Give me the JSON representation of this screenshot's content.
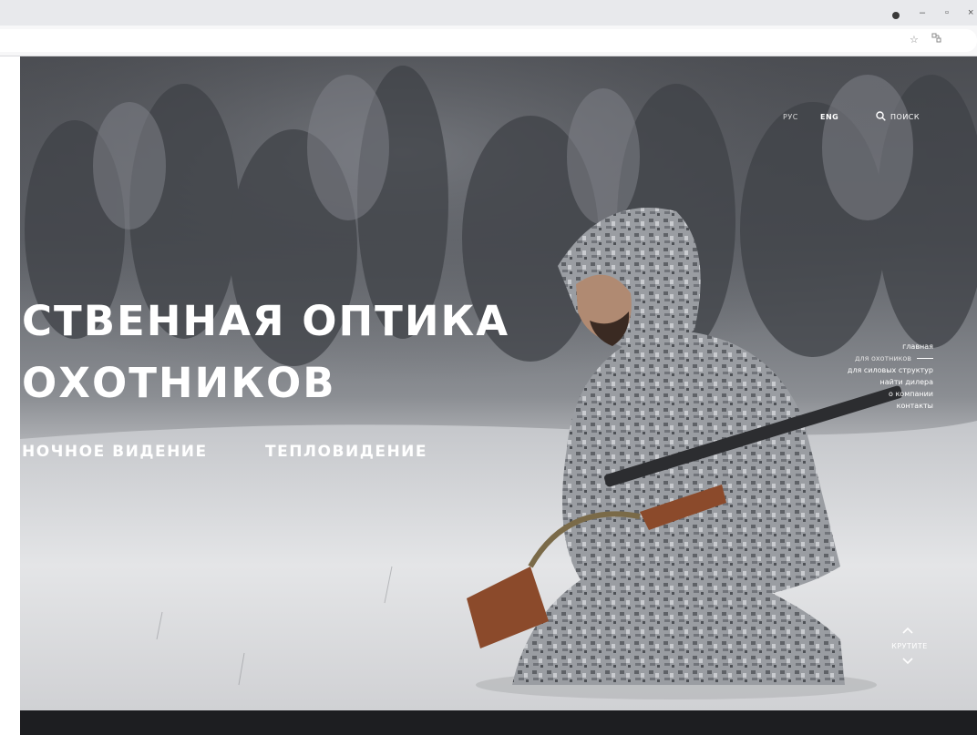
{
  "browser": {
    "window_controls": {
      "minimize": "–",
      "maximize": "▫",
      "close": "×"
    },
    "toolbar_icons": [
      "star-icon",
      "extension-icon"
    ]
  },
  "header": {
    "lang_ru": "РУС",
    "lang_en": "ENG",
    "search_label": "ПОИСК",
    "search_icon": "search-icon"
  },
  "hero": {
    "headline_line1": "СТВЕННАЯ ОПТИКА",
    "headline_line2": "ОХОТНИКОВ",
    "categories": [
      {
        "label": "НОЧНОЕ ВИДЕНИЕ"
      },
      {
        "label": "ТЕПЛОВИДЕНИЕ"
      }
    ]
  },
  "side_menu": {
    "items": [
      {
        "label": "главная",
        "active": false
      },
      {
        "label": "для охотников",
        "active": true
      },
      {
        "label": "для силовых структур",
        "active": false
      },
      {
        "label": "найти дилера",
        "active": false
      },
      {
        "label": "о компании",
        "active": false
      },
      {
        "label": "контакты",
        "active": false
      }
    ]
  },
  "scroll_hint": {
    "label": "КРУТИТЕ",
    "up_icon": "chevron-up-icon",
    "down_icon": "chevron-down-icon"
  },
  "colors": {
    "headline": "#ffffff",
    "bottom_bar": "#1d1e21",
    "chrome_bg": "#e8e9ec"
  }
}
